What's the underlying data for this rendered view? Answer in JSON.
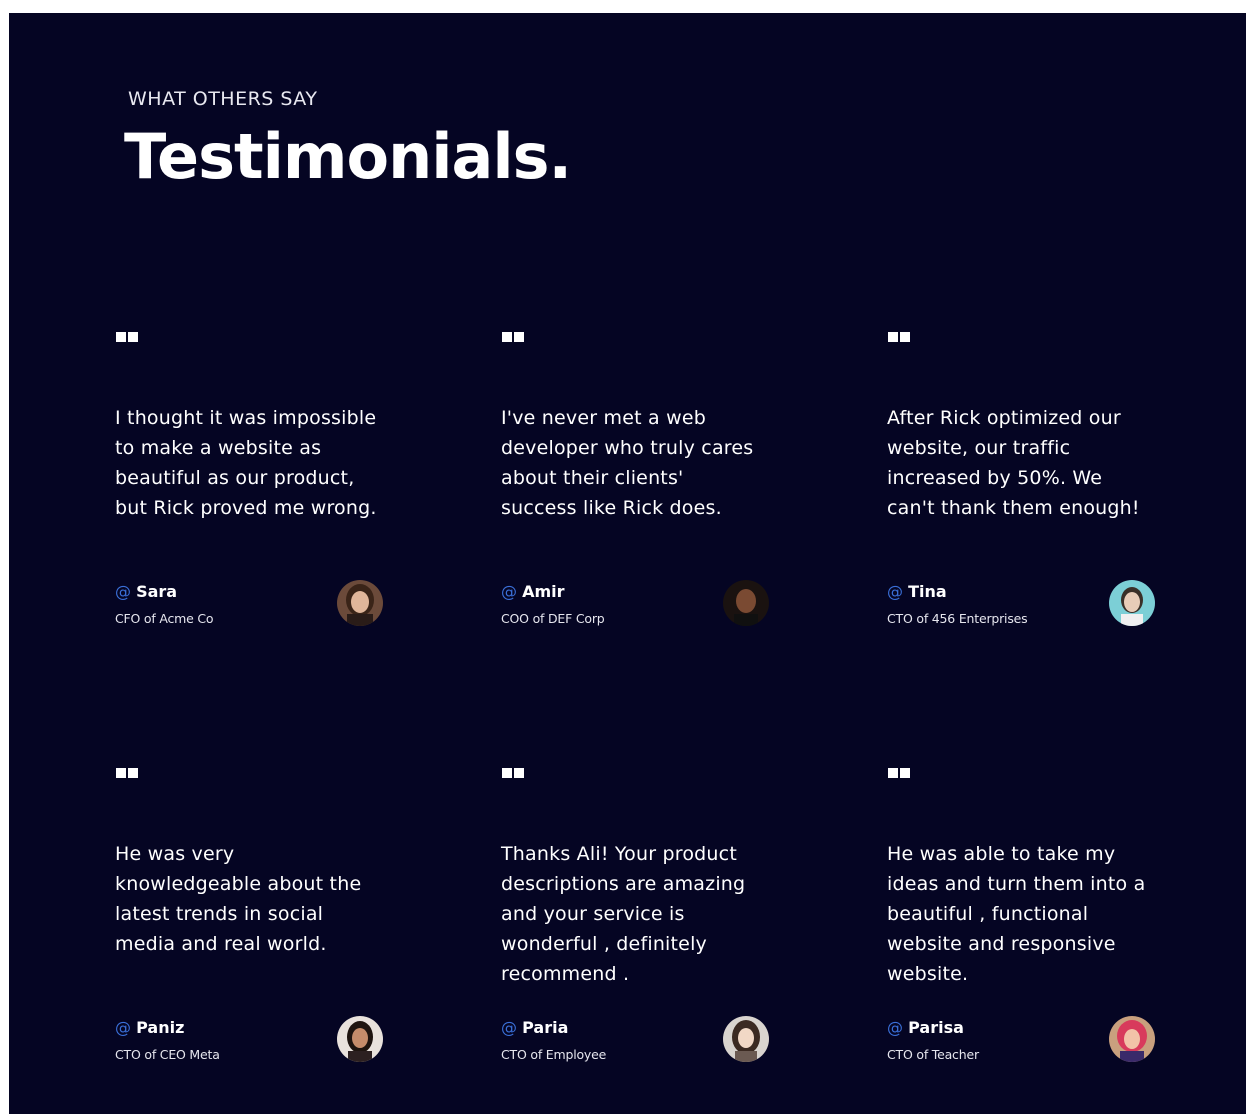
{
  "header": {
    "eyebrow": "WHAT OTHERS SAY",
    "title": "Testimonials."
  },
  "colors": {
    "background": "#050523",
    "accent": "#3a6fd8",
    "text": "#ffffff"
  },
  "testimonials": [
    {
      "quote": "I thought it was impossible to make a website as beautiful as our product, but Rick proved me wrong.",
      "at": "@",
      "name": "Sara",
      "role": "CFO of Acme Co",
      "avatar_icon": "avatar-photo"
    },
    {
      "quote": "I've never met a web developer who truly cares about their clients' success like Rick does.",
      "at": "@",
      "name": "Amir",
      "role": "COO of DEF Corp",
      "avatar_icon": "avatar-photo"
    },
    {
      "quote": "After Rick optimized our website, our traffic increased by 50%. We can't thank them enough!",
      "at": "@",
      "name": "Tina",
      "role": "CTO of 456 Enterprises",
      "avatar_icon": "avatar-photo"
    },
    {
      "quote": "He was very knowledgeable about the latest trends in social media and real world.",
      "at": "@",
      "name": "Paniz",
      "role": "CTO of CEO Meta",
      "avatar_icon": "avatar-photo"
    },
    {
      "quote": "Thanks Ali! Your product descriptions are amazing and your service is wonderful , definitely recommend .",
      "at": "@",
      "name": "Paria",
      "role": "CTO of Employee",
      "avatar_icon": "avatar-photo"
    },
    {
      "quote": "He was able to take my ideas and turn them into a beautiful , functional website and responsive website.",
      "at": "@",
      "name": "Parisa",
      "role": "CTO of Teacher",
      "avatar_icon": "avatar-photo"
    }
  ]
}
